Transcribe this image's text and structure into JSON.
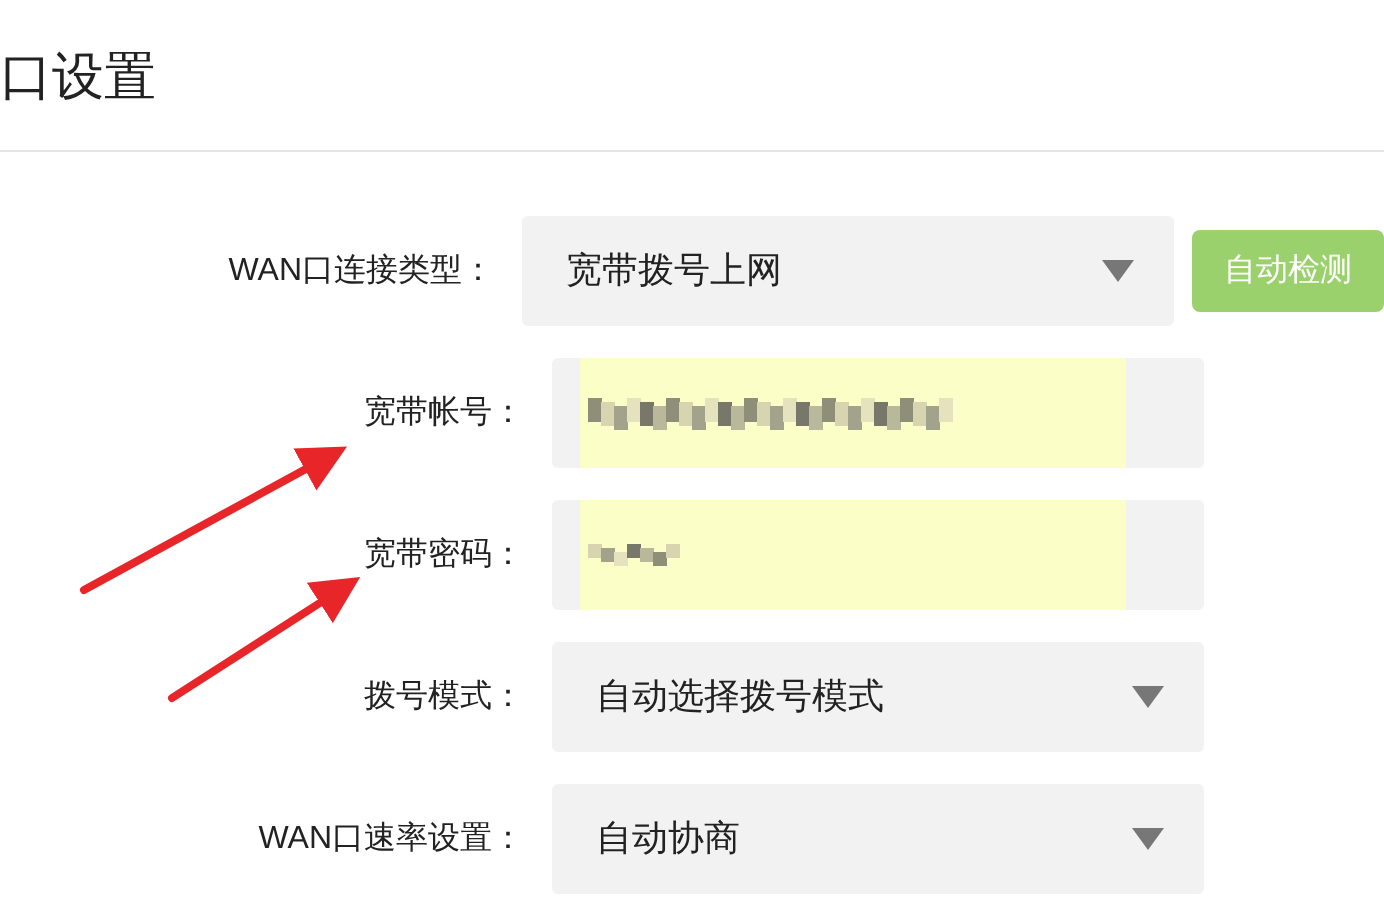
{
  "title": "口设置",
  "fields": [
    {
      "label": "WAN口连接类型：",
      "kind": "select",
      "value": "宽带拨号上网",
      "button": "自动检测"
    },
    {
      "label": "宽带帐号：",
      "kind": "redacted"
    },
    {
      "label": "宽带密码：",
      "kind": "redacted"
    },
    {
      "label": "拨号模式：",
      "kind": "select",
      "value": "自动选择拨号模式"
    },
    {
      "label": "WAN口速率设置：",
      "kind": "select",
      "value": "自动协商"
    }
  ]
}
